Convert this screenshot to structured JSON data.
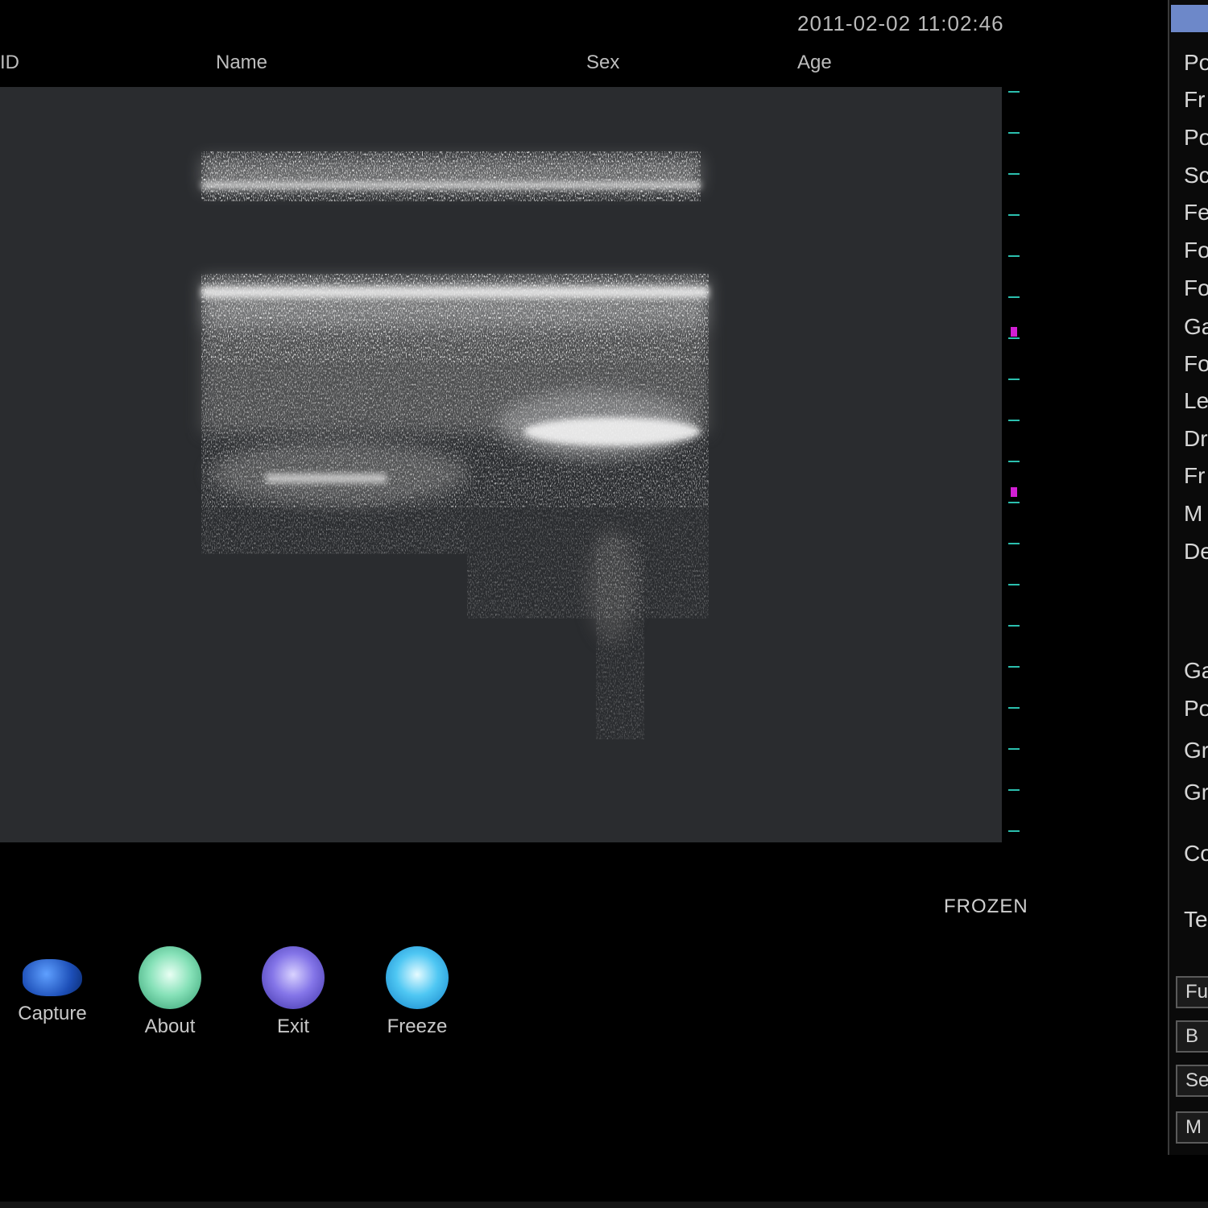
{
  "header": {
    "datetime": "2011-02-02 11:02:46",
    "id_label": "ID",
    "name_label": "Name",
    "sex_label": "Sex",
    "age_label": "Age"
  },
  "status": {
    "frozen": "FROZEN"
  },
  "toolbar": {
    "capture": "Capture",
    "about": "About",
    "exit": "Exit",
    "freeze": "Freeze"
  },
  "sidebar": {
    "items": [
      "Po",
      "Fr",
      "Po",
      "Sc",
      "Fe",
      "Fo",
      "Fo",
      "Ga",
      "Fo",
      "Le",
      "Dr",
      "Fr",
      "M",
      "De",
      "Ga",
      "Po",
      "Gr",
      "Gr",
      "Co",
      "Te"
    ],
    "buttons": [
      "Fu",
      "B",
      "Se",
      "M"
    ]
  },
  "colors": {
    "background": "#000000",
    "image_area": "#2a2c2f",
    "scale_tick": "#2bbfae",
    "focus_marker": "#d21fd4"
  }
}
